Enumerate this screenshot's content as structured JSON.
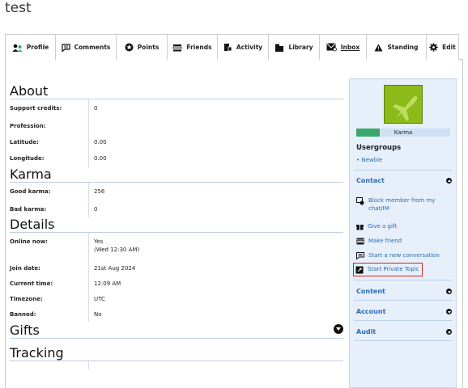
{
  "page": {
    "title": "test"
  },
  "tabs": [
    {
      "label": "Profile",
      "icon": "user-group-icon"
    },
    {
      "label": "Comments",
      "icon": "comment-icon"
    },
    {
      "label": "Points",
      "icon": "star-badge-icon"
    },
    {
      "label": "Friends",
      "icon": "friends-icon"
    },
    {
      "label": "Activity",
      "icon": "activity-icon"
    },
    {
      "label": "Library",
      "icon": "library-icon"
    },
    {
      "label": "Inbox",
      "icon": "inbox-icon"
    },
    {
      "label": "Standing",
      "icon": "warning-icon"
    },
    {
      "label": "Edit",
      "icon": "gear-icon"
    }
  ],
  "about": {
    "title": "About",
    "rows": [
      {
        "k": "Support credits:",
        "v": "0"
      },
      {
        "k": "Profession:",
        "v": ""
      },
      {
        "k": "Latitude:",
        "v": "0.00"
      },
      {
        "k": "Longitude:",
        "v": "0.00"
      }
    ]
  },
  "karma_section": {
    "title": "Karma",
    "rows": [
      {
        "k": "Good karma:",
        "v": "256"
      },
      {
        "k": "Bad karma:",
        "v": "0"
      }
    ]
  },
  "details": {
    "title": "Details",
    "online_k": "Online now:",
    "online_v": "Yes",
    "online_sub": "(Wed 12:30 AM)",
    "rows": [
      {
        "k": "Join date:",
        "v": "21st Aug 2024"
      },
      {
        "k": "Current time:",
        "v": "12:09 AM"
      },
      {
        "k": "Timezone:",
        "v": "UTC"
      },
      {
        "k": "Banned:",
        "v": "No"
      }
    ]
  },
  "gifts": {
    "title": "Gifts"
  },
  "tracking": {
    "title": "Tracking"
  },
  "sidebar": {
    "karma_label": "Karma",
    "karma_level": 0.25,
    "usergroups_title": "Usergroups",
    "usergroup": "Newbie",
    "contact_title": "Contact",
    "actions": [
      {
        "label": "Block member from my chat/IM",
        "icon": "block-chat-icon"
      },
      {
        "label": "Give a gift",
        "icon": "gift-icon"
      },
      {
        "label": "Make friend",
        "icon": "friends-icon"
      },
      {
        "label": "Start a new conversation",
        "icon": "comment-icon"
      },
      {
        "label": "Start Private Topic",
        "icon": "private-topic-icon"
      }
    ],
    "content_title": "Content",
    "account_title": "Account",
    "audit_title": "Audit"
  },
  "colors": {
    "link": "#2b6cb0",
    "accent_green": "#3aa76d",
    "avatar_green": "#8cba18",
    "panel_bg": "#e6effa",
    "highlight": "#d0281f"
  }
}
